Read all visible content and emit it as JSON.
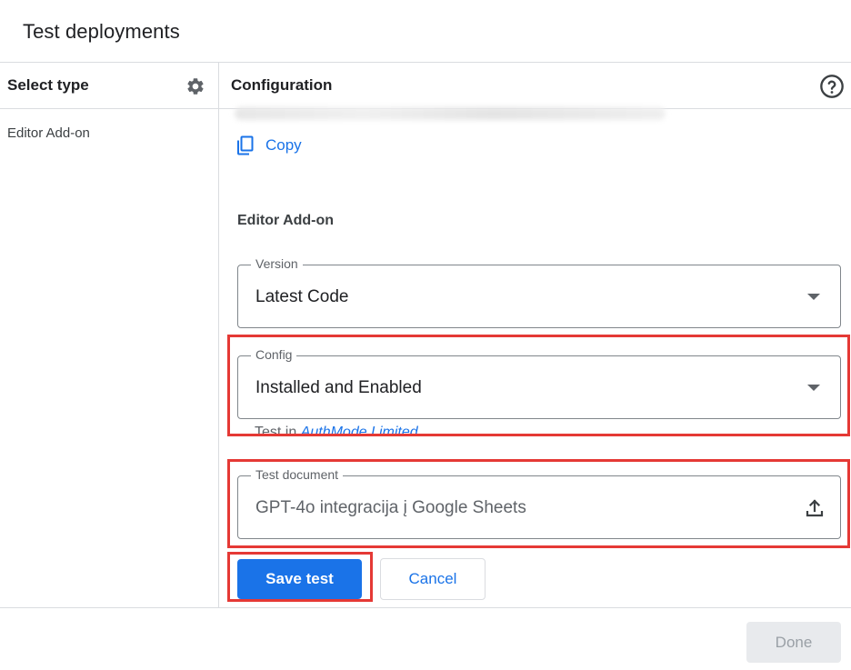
{
  "dialog": {
    "title": "Test deployments"
  },
  "left_panel": {
    "header": "Select type",
    "settings_icon": "gear-icon",
    "items": [
      {
        "label": "Editor Add-on"
      }
    ]
  },
  "right_panel": {
    "header": "Configuration",
    "help_icon": "help-circle-icon",
    "copy_label": "Copy",
    "copy_icon": "copy-icon",
    "section_title": "Editor Add-on",
    "version": {
      "legend": "Version",
      "value": "Latest Code"
    },
    "config": {
      "legend": "Config",
      "value": "Installed and Enabled",
      "hint_prefix": "Test in ",
      "hint_link": "AuthMode.Limited"
    },
    "test_document": {
      "legend": "Test document",
      "value": "GPT-4o integracija į Google Sheets",
      "upload_icon": "upload-icon"
    }
  },
  "actions": {
    "save_label": "Save test",
    "cancel_label": "Cancel",
    "done_label": "Done"
  },
  "colors": {
    "accent": "#1a73e8",
    "highlight": "#e53935",
    "divider": "#dadce0"
  }
}
